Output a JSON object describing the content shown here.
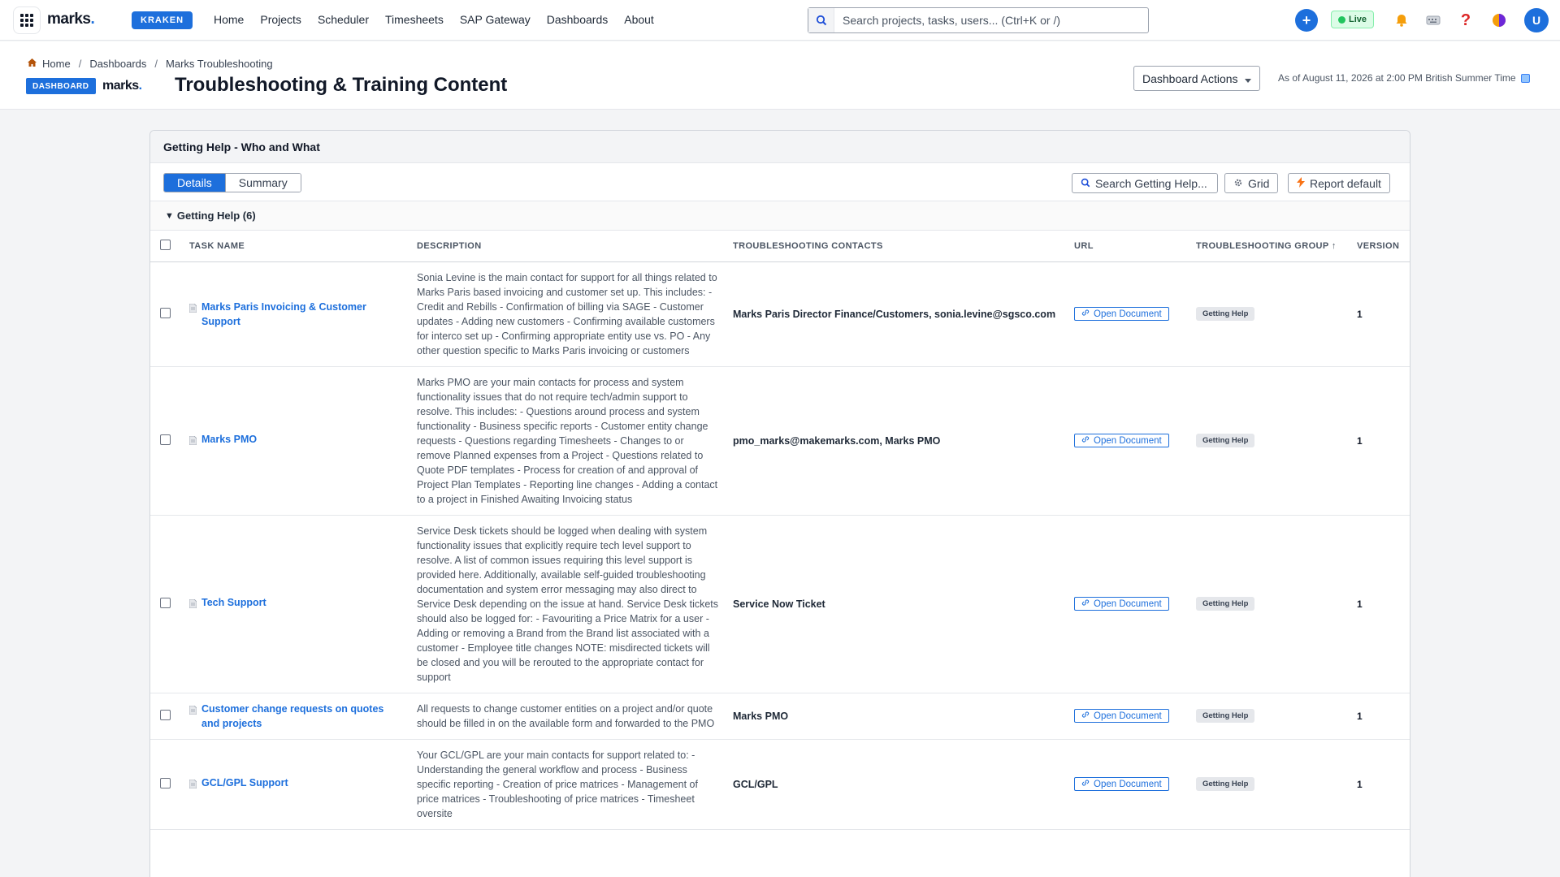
{
  "nav": {
    "logo_text": "marks",
    "logo_dot": ".",
    "env_badge": "KRAKEN",
    "links": [
      "Home",
      "Projects",
      "Scheduler",
      "Timesheets",
      "SAP Gateway",
      "Dashboards",
      "About"
    ],
    "search_placeholder": "Search projects, tasks, users... (Ctrl+K or /)",
    "live_label": "Live",
    "avatar_initial": "U"
  },
  "header": {
    "breadcrumb": [
      "Home",
      "Dashboards",
      "Marks Troubleshooting"
    ],
    "badge": "DASHBOARD",
    "small_logo": "marks",
    "title": "Troubleshooting & Training Content",
    "actions_label": "Dashboard Actions",
    "as_of": "As of August 11, 2026 at 2:00 PM British Summer Time"
  },
  "panel": {
    "title": "Getting Help - Who and What",
    "tabs": [
      "Details",
      "Summary"
    ],
    "active_tab": "Details",
    "search_label": "Search Getting Help...",
    "grid_label": "Grid",
    "report_default_label": "Report default",
    "group_label": "Getting Help (6)",
    "columns": [
      "TASK NAME",
      "DESCRIPTION",
      "TROUBLESHOOTING CONTACTS",
      "URL",
      "TROUBLESHOOTING GROUP ↑",
      "VERSION"
    ],
    "rows": [
      {
        "task": "Marks Paris Invoicing & Customer Support",
        "description": "Sonia Levine is the main contact for support for all things related to Marks Paris based invoicing and customer set up. This includes: - Credit and Rebills - Confirmation of billing via SAGE - Customer updates - Adding new customers - Confirming available customers for interco set up - Confirming appropriate entity use vs. PO - Any other question specific to Marks Paris invoicing or customers",
        "contact": "Marks Paris Director Finance/Customers, sonia.levine@sgsco.com",
        "url_label": "Open Document",
        "group": "Getting Help",
        "version": "1"
      },
      {
        "task": "Marks PMO",
        "description": "Marks PMO are your main contacts for process and system functionality issues that do not require tech/admin support to resolve. This includes: - Questions around process and system functionality - Business specific reports - Customer entity change requests - Questions regarding Timesheets - Changes to or remove Planned expenses from a Project - Questions related to Quote PDF templates - Process for creation of and approval of Project Plan Templates - Reporting line changes - Adding a contact to a project in Finished Awaiting Invoicing status",
        "contact": "pmo_marks@makemarks.com, Marks PMO",
        "url_label": "Open Document",
        "group": "Getting Help",
        "version": "1"
      },
      {
        "task": "Tech Support",
        "description": "Service Desk tickets should be logged when dealing with system functionality issues that explicitly require tech level support to resolve. A list of common issues requiring this level support is provided here. Additionally, available self-guided troubleshooting documentation and system error messaging may also direct to Service Desk depending on the issue at hand. Service Desk tickets should also be logged for: - Favouriting a Price Matrix for a user - Adding or removing a Brand from the Brand list associated with a customer - Employee title changes NOTE: misdirected tickets will be closed and you will be rerouted to the appropriate contact for support",
        "contact": "Service Now Ticket",
        "url_label": "Open Document",
        "group": "Getting Help",
        "version": "1"
      },
      {
        "task": "Customer change requests on quotes and projects",
        "description": "All requests to change customer entities on a project and/or quote should be filled in on the available form and forwarded to the PMO",
        "contact": "Marks PMO",
        "url_label": "Open Document",
        "group": "Getting Help",
        "version": "1"
      },
      {
        "task": "GCL/GPL Support",
        "description": "Your GCL/GPL are your main contacts for support related to: - Understanding the general workflow and process - Business specific reporting - Creation of price matrices - Management of price matrices - Troubleshooting of price matrices - Timesheet oversite",
        "contact": "GCL/GPL",
        "url_label": "Open Document",
        "group": "Getting Help",
        "version": "1"
      }
    ]
  },
  "colors": {
    "brand_blue": "#1d6fdc",
    "live_green": "#22c55e"
  }
}
